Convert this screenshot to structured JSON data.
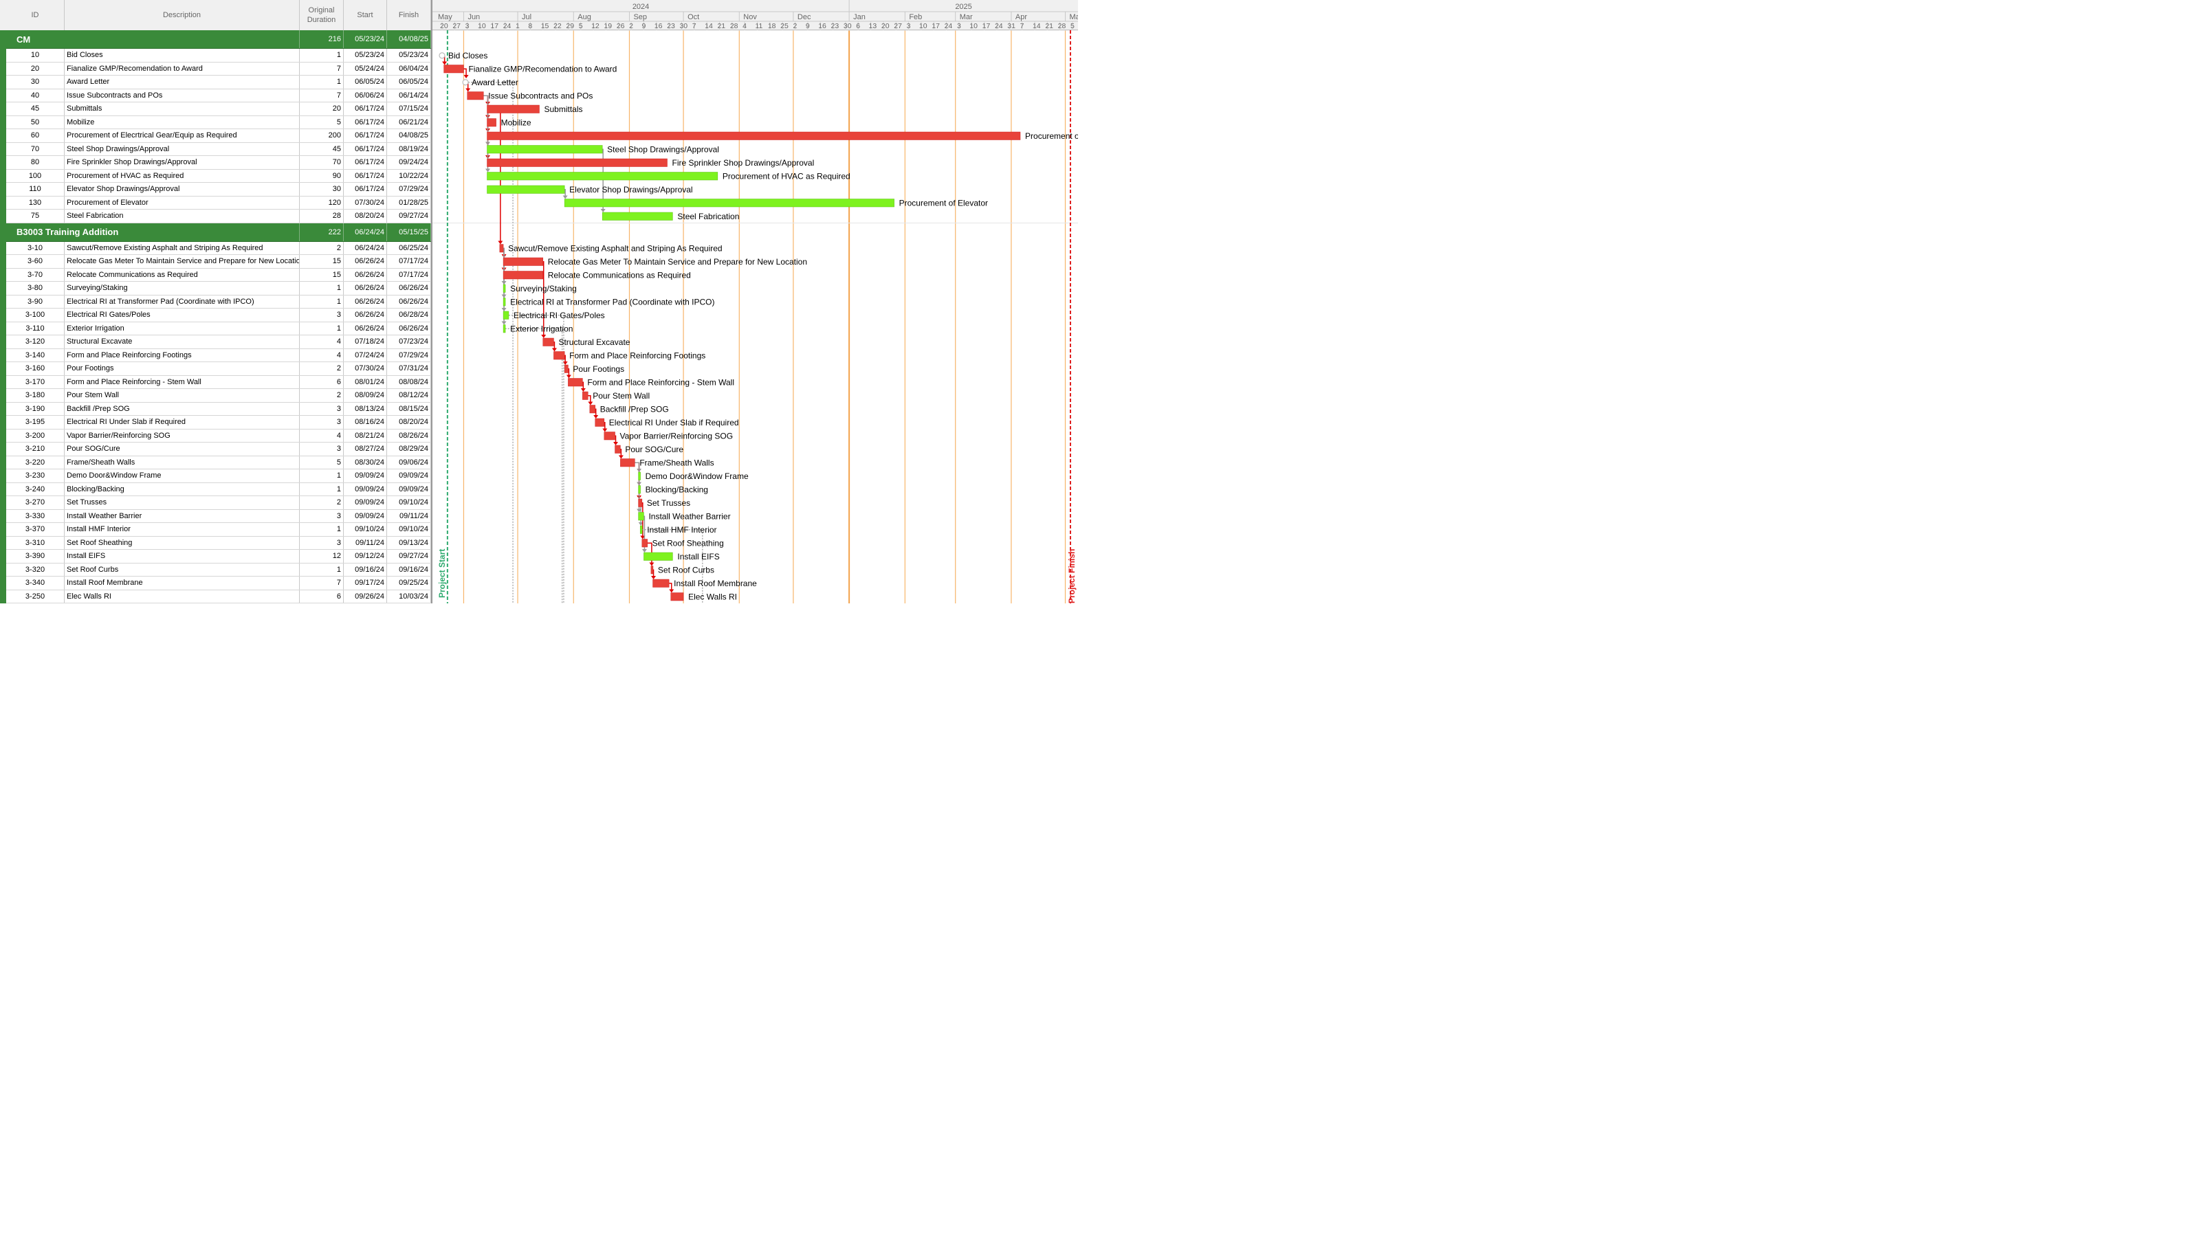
{
  "columns": {
    "id": "ID",
    "description": "Description",
    "duration_line1": "Original",
    "duration_line2": "Duration",
    "start": "Start",
    "finish": "Finish"
  },
  "timeline": {
    "years": [
      "2024",
      "2025"
    ],
    "months": [
      "May",
      "Jun",
      "Jul",
      "Aug",
      "Sep",
      "Oct",
      "Nov",
      "Dec",
      "Jan",
      "Feb",
      "Mar",
      "Apr",
      "May"
    ],
    "week_days": [
      "20",
      "27",
      "3",
      "10",
      "17",
      "24",
      "1",
      "8",
      "15",
      "22",
      "29",
      "5",
      "12",
      "19",
      "26",
      "2",
      "9",
      "16",
      "23",
      "30",
      "7",
      "14",
      "21",
      "28",
      "4",
      "11",
      "18",
      "25",
      "2",
      "9",
      "16",
      "23",
      "30",
      "6",
      "13",
      "20",
      "27",
      "3",
      "10",
      "17",
      "24",
      "3",
      "10",
      "17",
      "24",
      "31",
      "7",
      "14",
      "21",
      "28",
      "5",
      "12"
    ],
    "start_marker": "Project Start",
    "finish_marker": "Project Finish"
  },
  "colors": {
    "summary_green": "#3a8a3a",
    "critical_bar": "#e8433a",
    "noncritical_bar": "#7ef21f",
    "link_critical": "#e00000",
    "link_noncritical": "#999999",
    "month_line": "#f7b56a",
    "year_line": "#f2a24c",
    "project_start": "#2eaa6e",
    "project_finish": "#e02020"
  },
  "rows": [
    {
      "kind": "summary",
      "name": "CM",
      "duration": "216",
      "start": "05/23/24",
      "finish": "04/08/25"
    },
    {
      "kind": "task",
      "id": "10",
      "desc": "Bid Closes",
      "duration": "1",
      "start": "05/23/24",
      "finish": "05/23/24",
      "bar": {
        "crit": true,
        "ms": true,
        "e": 0
      }
    },
    {
      "kind": "task",
      "id": "20",
      "desc": "Fianalize GMP/Recomendation to Award",
      "duration": "7",
      "start": "05/24/24",
      "finish": "06/04/24",
      "bar": {
        "crit": true,
        "s": 1,
        "e": 12
      }
    },
    {
      "kind": "task",
      "id": "30",
      "desc": "Award Letter",
      "duration": "1",
      "start": "06/05/24",
      "finish": "06/05/24",
      "bar": {
        "crit": true,
        "ms": true,
        "e": 13
      }
    },
    {
      "kind": "task",
      "id": "40",
      "desc": "Issue Subcontracts and POs",
      "duration": "7",
      "start": "06/06/24",
      "finish": "06/14/24",
      "bar": {
        "crit": true,
        "s": 14,
        "e": 23
      }
    },
    {
      "kind": "task",
      "id": "45",
      "desc": "Submittals",
      "duration": "20",
      "start": "06/17/24",
      "finish": "07/15/24",
      "bar": {
        "crit": true,
        "s": 25,
        "e": 54
      }
    },
    {
      "kind": "task",
      "id": "50",
      "desc": "Mobilize",
      "duration": "5",
      "start": "06/17/24",
      "finish": "06/21/24",
      "bar": {
        "crit": true,
        "s": 25,
        "e": 30
      }
    },
    {
      "kind": "task",
      "id": "60",
      "desc": "Procurement of Elecrtrical Gear/Equip as Required",
      "duration": "200",
      "start": "06/17/24",
      "finish": "04/08/25",
      "bar": {
        "crit": true,
        "s": 25,
        "e": 321,
        "label": "Procurement of Elecrtrical Gear/Equip as Required"
      }
    },
    {
      "kind": "task",
      "id": "70",
      "desc": "Steel Shop Drawings/Approval",
      "duration": "45",
      "start": "06/17/24",
      "finish": "08/19/24",
      "bar": {
        "crit": false,
        "s": 25,
        "e": 89
      }
    },
    {
      "kind": "task",
      "id": "80",
      "desc": "Fire Sprinkler Shop Drawings/Approval",
      "duration": "70",
      "start": "06/17/24",
      "finish": "09/24/24",
      "bar": {
        "crit": true,
        "s": 25,
        "e": 125
      }
    },
    {
      "kind": "task",
      "id": "100",
      "desc": "Procurement of HVAC as Required",
      "duration": "90",
      "start": "06/17/24",
      "finish": "10/22/24",
      "bar": {
        "crit": false,
        "s": 25,
        "e": 153
      }
    },
    {
      "kind": "task",
      "id": "110",
      "desc": "Elevator Shop Drawings/Approval",
      "duration": "30",
      "start": "06/17/24",
      "finish": "07/29/24",
      "bar": {
        "crit": false,
        "s": 25,
        "e": 68
      }
    },
    {
      "kind": "task",
      "id": "130",
      "desc": "Procurement of Elevator",
      "duration": "120",
      "start": "07/30/24",
      "finish": "01/28/25",
      "bar": {
        "crit": false,
        "s": 68,
        "e": 251
      }
    },
    {
      "kind": "task",
      "id": "75",
      "desc": "Steel Fabrication",
      "duration": "28",
      "start": "08/20/24",
      "finish": "09/27/24",
      "bar": {
        "crit": false,
        "s": 89,
        "e": 128
      }
    },
    {
      "kind": "summary",
      "name": "B3003 Training Addition",
      "duration": "222",
      "start": "06/24/24",
      "finish": "05/15/25"
    },
    {
      "kind": "task",
      "id": "3-10",
      "desc": "Sawcut/Remove Existing Asphalt and Striping As Required",
      "duration": "2",
      "start": "06/24/24",
      "finish": "06/25/24",
      "bar": {
        "crit": true,
        "s": 32,
        "e": 34
      }
    },
    {
      "kind": "task",
      "id": "3-60",
      "desc": "Relocate Gas Meter To Maintain Service and Prepare for New Location",
      "duration": "15",
      "start": "06/26/24",
      "finish": "07/17/24",
      "bar": {
        "crit": true,
        "s": 34,
        "e": 56
      }
    },
    {
      "kind": "task",
      "id": "3-70",
      "desc": "Relocate Communications as Required",
      "duration": "15",
      "start": "06/26/24",
      "finish": "07/17/24",
      "bar": {
        "crit": true,
        "s": 34,
        "e": 56
      }
    },
    {
      "kind": "task",
      "id": "3-80",
      "desc": "Surveying/Staking",
      "duration": "1",
      "start": "06/26/24",
      "finish": "06/26/24",
      "bar": {
        "crit": false,
        "s": 34,
        "e": 35
      }
    },
    {
      "kind": "task",
      "id": "3-90",
      "desc": "Electrical RI at Transformer Pad (Coordinate with IPCO)",
      "duration": "1",
      "start": "06/26/24",
      "finish": "06/26/24",
      "bar": {
        "crit": false,
        "s": 34,
        "e": 35
      }
    },
    {
      "kind": "task",
      "id": "3-100",
      "desc": "Electrical RI Gates/Poles",
      "duration": "3",
      "start": "06/26/24",
      "finish": "06/28/24",
      "bar": {
        "crit": false,
        "s": 34,
        "e": 37
      }
    },
    {
      "kind": "task",
      "id": "3-110",
      "desc": "Exterior Irrigation",
      "duration": "1",
      "start": "06/26/24",
      "finish": "06/26/24",
      "bar": {
        "crit": false,
        "s": 34,
        "e": 35
      }
    },
    {
      "kind": "task",
      "id": "3-120",
      "desc": "Structural Excavate",
      "duration": "4",
      "start": "07/18/24",
      "finish": "07/23/24",
      "bar": {
        "crit": true,
        "s": 56,
        "e": 62
      }
    },
    {
      "kind": "task",
      "id": "3-140",
      "desc": "Form and Place Reinforcing Footings",
      "duration": "4",
      "start": "07/24/24",
      "finish": "07/29/24",
      "bar": {
        "crit": true,
        "s": 62,
        "e": 68
      }
    },
    {
      "kind": "task",
      "id": "3-160",
      "desc": "Pour Footings",
      "duration": "2",
      "start": "07/30/24",
      "finish": "07/31/24",
      "bar": {
        "crit": true,
        "s": 68,
        "e": 70
      }
    },
    {
      "kind": "task",
      "id": "3-170",
      "desc": "Form and Place Reinforcing - Stem Wall",
      "duration": "6",
      "start": "08/01/24",
      "finish": "08/08/24",
      "bar": {
        "crit": true,
        "s": 70,
        "e": 78
      }
    },
    {
      "kind": "task",
      "id": "3-180",
      "desc": "Pour Stem Wall",
      "duration": "2",
      "start": "08/09/24",
      "finish": "08/12/24",
      "bar": {
        "crit": true,
        "s": 78,
        "e": 81
      }
    },
    {
      "kind": "task",
      "id": "3-190",
      "desc": "Backfill /Prep SOG",
      "duration": "3",
      "start": "08/13/24",
      "finish": "08/15/24",
      "bar": {
        "crit": true,
        "s": 82,
        "e": 85
      }
    },
    {
      "kind": "task",
      "id": "3-195",
      "desc": "Electrical RI Under Slab if Required",
      "duration": "3",
      "start": "08/16/24",
      "finish": "08/20/24",
      "bar": {
        "crit": true,
        "s": 85,
        "e": 90
      }
    },
    {
      "kind": "task",
      "id": "3-200",
      "desc": "Vapor Barrier/Reinforcing SOG",
      "duration": "4",
      "start": "08/21/24",
      "finish": "08/26/24",
      "bar": {
        "crit": true,
        "s": 90,
        "e": 96
      }
    },
    {
      "kind": "task",
      "id": "3-210",
      "desc": "Pour SOG/Cure",
      "duration": "3",
      "start": "08/27/24",
      "finish": "08/29/24",
      "bar": {
        "crit": true,
        "s": 96,
        "e": 99
      }
    },
    {
      "kind": "task",
      "id": "3-220",
      "desc": "Frame/Sheath Walls",
      "duration": "5",
      "start": "08/30/24",
      "finish": "09/06/24",
      "bar": {
        "crit": true,
        "s": 99,
        "e": 107
      }
    },
    {
      "kind": "task",
      "id": "3-230",
      "desc": "Demo Door&Window Frame",
      "duration": "1",
      "start": "09/09/24",
      "finish": "09/09/24",
      "bar": {
        "crit": false,
        "s": 109,
        "e": 110
      }
    },
    {
      "kind": "task",
      "id": "3-240",
      "desc": "Blocking/Backing",
      "duration": "1",
      "start": "09/09/24",
      "finish": "09/09/24",
      "bar": {
        "crit": false,
        "s": 109,
        "e": 110
      }
    },
    {
      "kind": "task",
      "id": "3-270",
      "desc": "Set Trusses",
      "duration": "2",
      "start": "09/09/24",
      "finish": "09/10/24",
      "bar": {
        "crit": true,
        "s": 109,
        "e": 111
      }
    },
    {
      "kind": "task",
      "id": "3-330",
      "desc": "Install Weather Barrier",
      "duration": "3",
      "start": "09/09/24",
      "finish": "09/11/24",
      "bar": {
        "crit": false,
        "s": 109,
        "e": 112
      }
    },
    {
      "kind": "task",
      "id": "3-370",
      "desc": "Install HMF Interior",
      "duration": "1",
      "start": "09/10/24",
      "finish": "09/10/24",
      "bar": {
        "crit": false,
        "s": 110,
        "e": 111
      }
    },
    {
      "kind": "task",
      "id": "3-310",
      "desc": "Set Roof Sheathing",
      "duration": "3",
      "start": "09/11/24",
      "finish": "09/13/24",
      "bar": {
        "crit": true,
        "s": 111,
        "e": 114
      }
    },
    {
      "kind": "task",
      "id": "3-390",
      "desc": "Install EIFS",
      "duration": "12",
      "start": "09/12/24",
      "finish": "09/27/24",
      "bar": {
        "crit": false,
        "s": 112,
        "e": 128
      }
    },
    {
      "kind": "task",
      "id": "3-320",
      "desc": "Set Roof Curbs",
      "duration": "1",
      "start": "09/16/24",
      "finish": "09/16/24",
      "bar": {
        "crit": true,
        "s": 116,
        "e": 117
      }
    },
    {
      "kind": "task",
      "id": "3-340",
      "desc": "Install Roof Membrane",
      "duration": "7",
      "start": "09/17/24",
      "finish": "09/25/24",
      "bar": {
        "crit": true,
        "s": 117,
        "e": 126
      }
    },
    {
      "kind": "task",
      "id": "3-250",
      "desc": "Elec Walls RI",
      "duration": "6",
      "start": "09/26/24",
      "finish": "10/03/24",
      "bar": {
        "crit": true,
        "s": 127,
        "e": 134
      }
    }
  ]
}
